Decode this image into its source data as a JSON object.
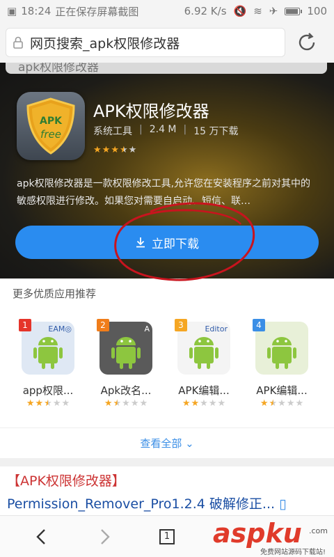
{
  "status_bar": {
    "notification": "正在保存屏幕截图",
    "time": "18:24",
    "network_speed": "6.92 K/s",
    "battery_level": "100",
    "battery_fraction": 1.0
  },
  "address_bar": {
    "url_text": "网页搜索_apk权限修改器",
    "lock_icon": "lock-icon",
    "reload_icon": "reload-icon"
  },
  "hero": {
    "search_text": "apk权限修改器",
    "app": {
      "name": "APK权限修改器",
      "icon_text_top": "APK",
      "icon_text_bottom": "free",
      "category": "系统工具",
      "size": "2.4 M",
      "downloads": "15 万下载",
      "rating": 3.5,
      "description": "apk权限修改器是一款权限修改工具,允许您在安装程序之前对其中的敏感权限进行修改。如果您对需要自启动、短信、联…"
    },
    "download_label": "立即下载",
    "colors": {
      "button": "#2a8cf0",
      "annotation": "#c8141e"
    }
  },
  "recommendations": {
    "header": "更多优质应用推荐",
    "items": [
      {
        "rank": "1",
        "name": "app权限...",
        "rating": 2.5,
        "badge_color": "#e5342a",
        "icon_text": "EAM◎"
      },
      {
        "rank": "2",
        "name": "Apk改名...",
        "rating": 1.5,
        "badge_color": "#f07d1a",
        "icon_text": "A"
      },
      {
        "rank": "3",
        "name": "APK编辑...",
        "rating": 2.0,
        "badge_color": "#f5a623",
        "icon_text": "Editor"
      },
      {
        "rank": "4",
        "name": "APK编辑...",
        "rating": 1.5,
        "badge_color": "#3a8ee6",
        "icon_text": ""
      }
    ],
    "see_all": "查看全部"
  },
  "result": {
    "title": "【APK权限修改器】",
    "subtitle": "Permission_Remover_Pro1.2.4 破解修正..."
  },
  "nav": {
    "back_icon": "back-icon",
    "forward_icon": "forward-icon",
    "tab_count": "1"
  },
  "watermark": {
    "brand": "aspku",
    "tagline": "免费网站源码下载站!",
    "suffix": ".com"
  }
}
